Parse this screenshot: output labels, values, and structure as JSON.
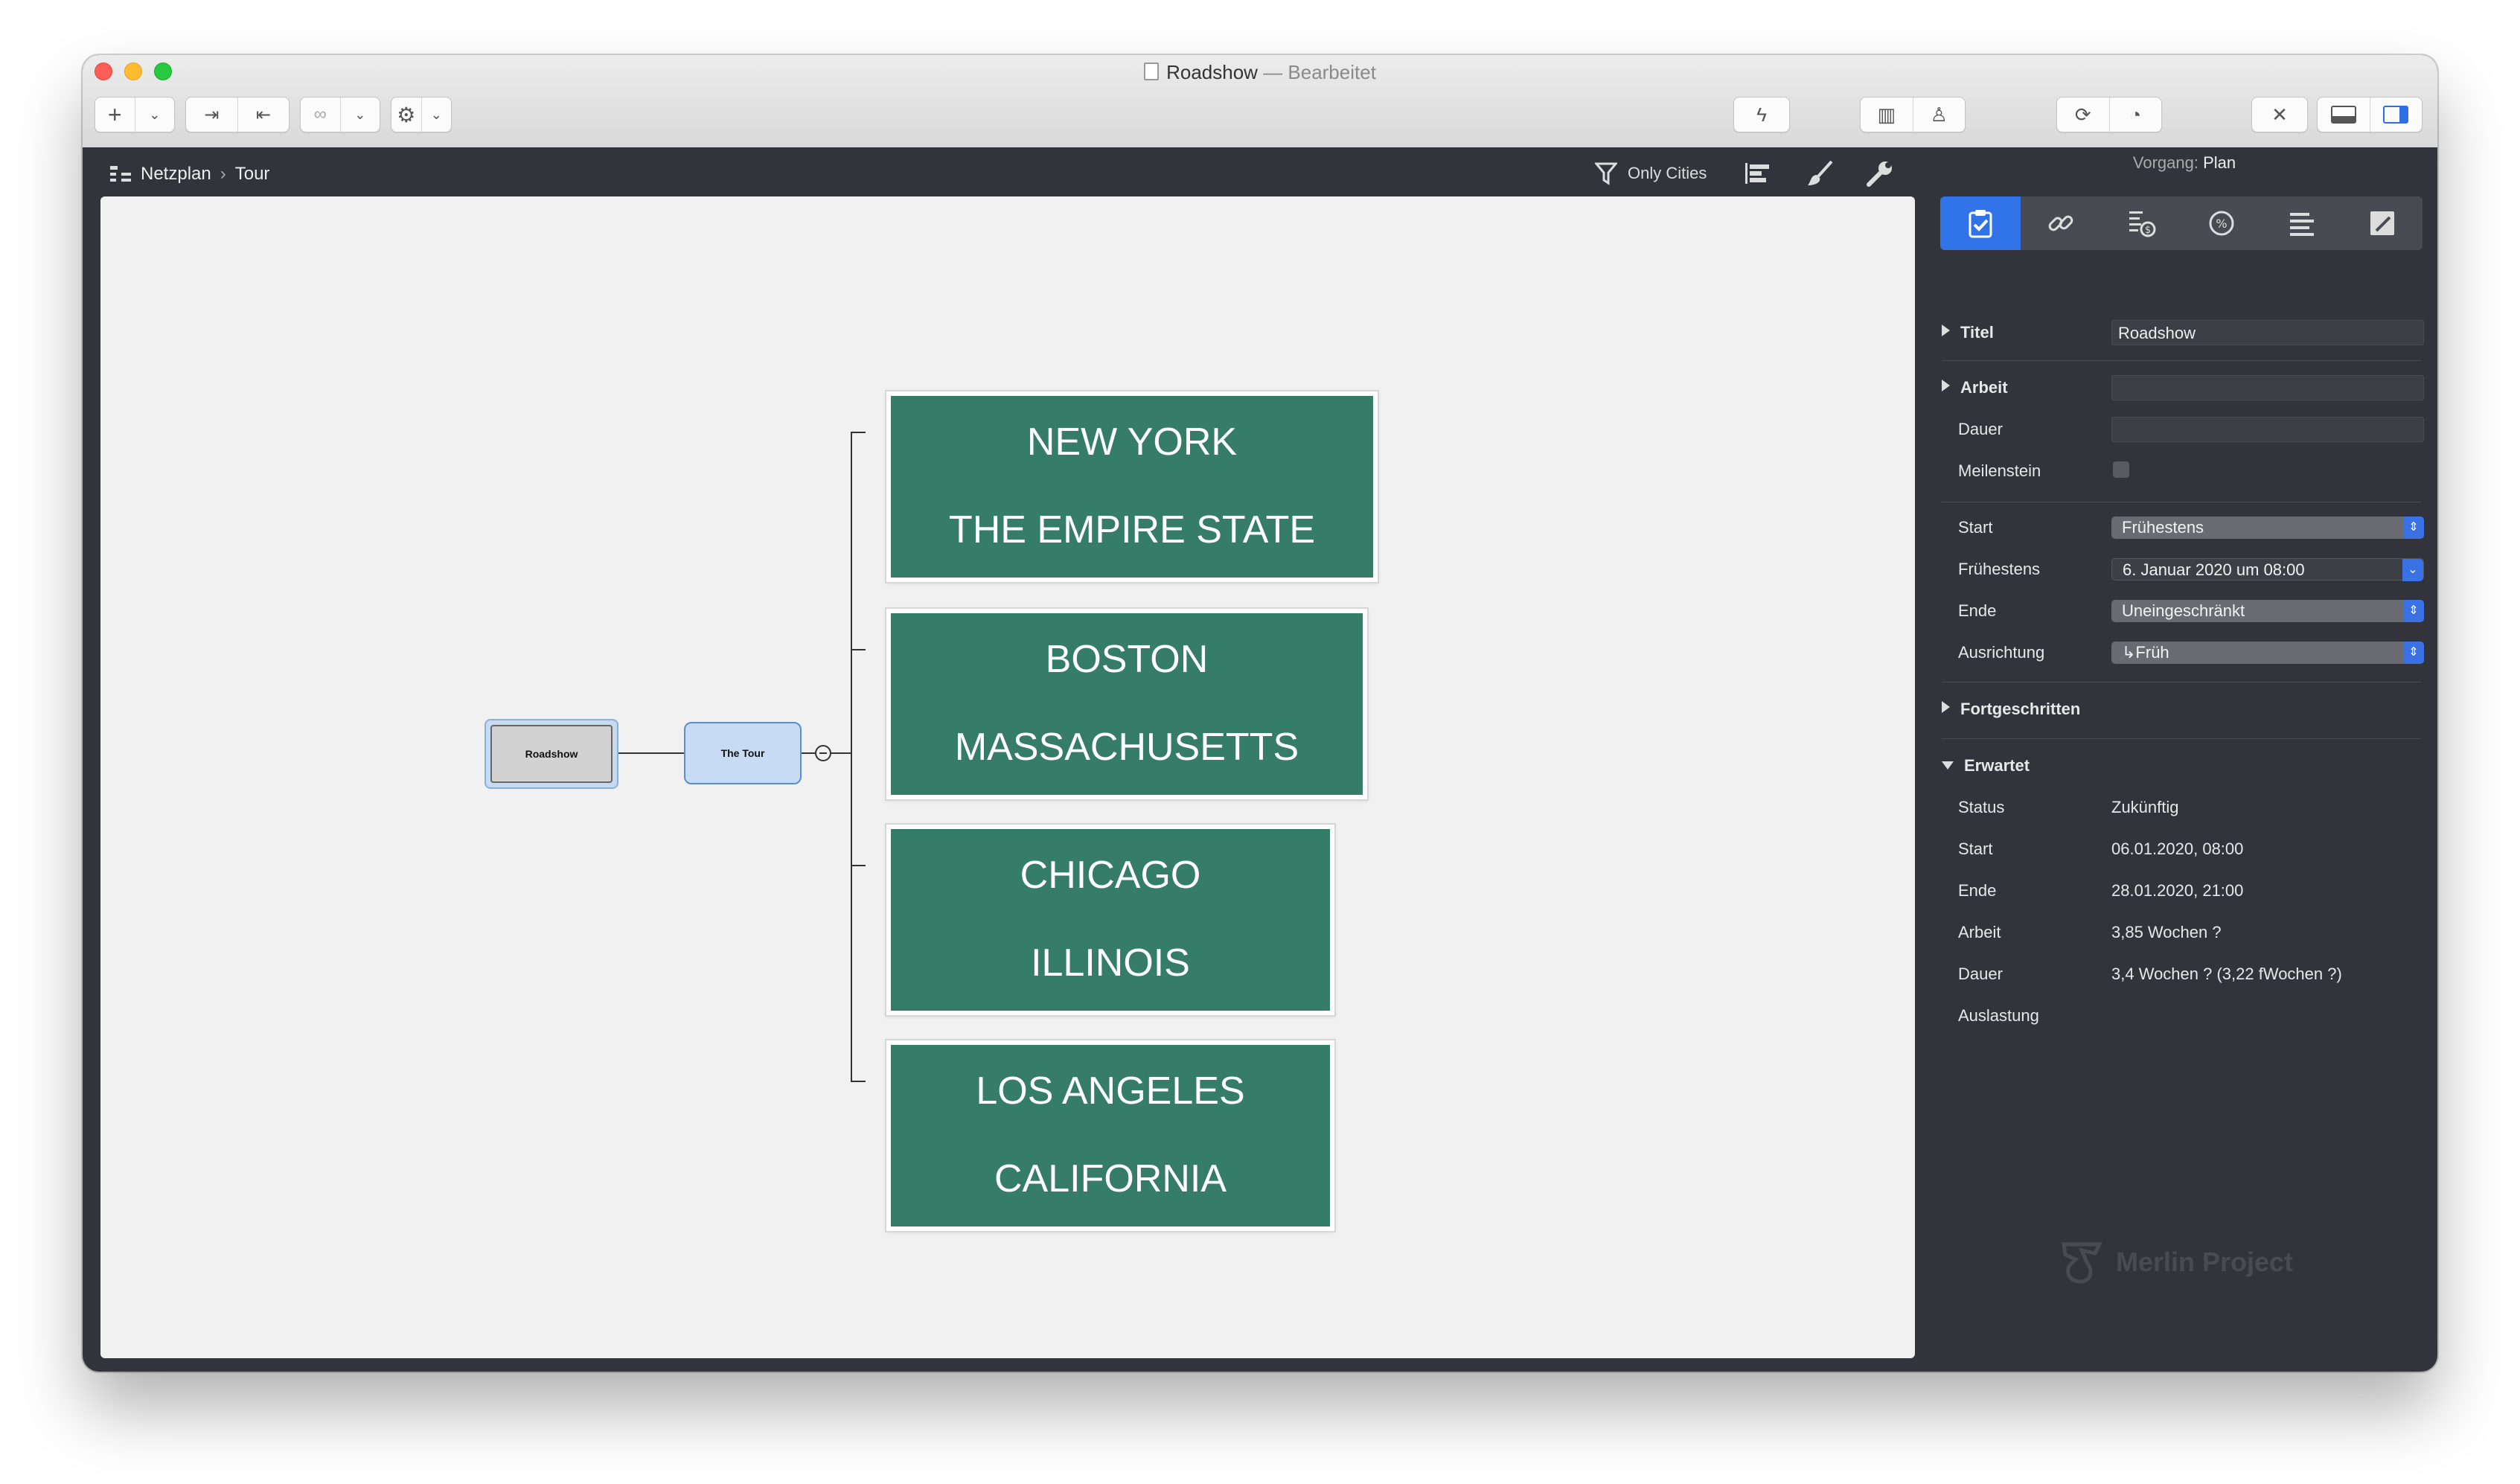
{
  "window": {
    "title": "Roadshow",
    "title_sep": " — ",
    "status": "Bearbeitet"
  },
  "toolbar": {
    "icons": [
      "plus-icon",
      "chevron-down-icon",
      "indent-icon",
      "outdent-icon",
      "link-icon",
      "chevron-down-icon",
      "gear-icon",
      "chevron-down-icon",
      "lightning-icon",
      "library-icon",
      "person-icon",
      "sync-icon",
      "dashboard-icon",
      "tools-icon",
      "bottom-panel-icon",
      "sidebar-icon"
    ]
  },
  "pathbar": {
    "breadcrumb": [
      "Netzplan",
      "Tour"
    ],
    "filter_label": "Only Cities"
  },
  "diagram": {
    "root": "Roadshow",
    "tour": "The Tour",
    "cities": [
      {
        "city": "NEW YORK",
        "state": "THE EMPIRE STATE"
      },
      {
        "city": "BOSTON",
        "state": "MASSACHUSETTS"
      },
      {
        "city": "CHICAGO",
        "state": "ILLINOIS"
      },
      {
        "city": "LOS ANGELES",
        "state": "CALIFORNIA"
      }
    ],
    "colors": {
      "city_fill": "#367d68",
      "root_fill": "#d2d2d2",
      "tour_fill": "#c7dcf4"
    }
  },
  "inspector": {
    "header_label": "Vorgang:",
    "header_value": "Plan",
    "tabs": [
      "clipboard-check-icon",
      "link-icon",
      "cost-icon",
      "percent-icon",
      "list-icon",
      "edit-icon"
    ],
    "titel_label": "Titel",
    "titel_value": "Roadshow",
    "arbeit_label": "Arbeit",
    "dauer_label": "Dauer",
    "meilenstein_label": "Meilenstein",
    "start_label": "Start",
    "start_value": "Frühestens",
    "fruehestens_label": "Frühestens",
    "fruehestens_value": "6. Januar 2020 um 08:00",
    "ende_label": "Ende",
    "ende_value": "Uneingeschränkt",
    "ausrichtung_label": "Ausrichtung",
    "ausrichtung_value": "↳Früh",
    "fortgeschritten_label": "Fortgeschritten",
    "erwartet_label": "Erwartet",
    "erwartet": {
      "status_label": "Status",
      "status_value": "Zukünftig",
      "start_label": "Start",
      "start_value": "06.01.2020, 08:00",
      "ende_label": "Ende",
      "ende_value": "28.01.2020, 21:00",
      "arbeit_label": "Arbeit",
      "arbeit_value": "3,85 Wochen ?",
      "dauer_label": "Dauer",
      "dauer_value": "3,4 Wochen ? (3,22 fWochen ?)",
      "auslastung_label": "Auslastung"
    },
    "brand": "Merlin Project"
  }
}
